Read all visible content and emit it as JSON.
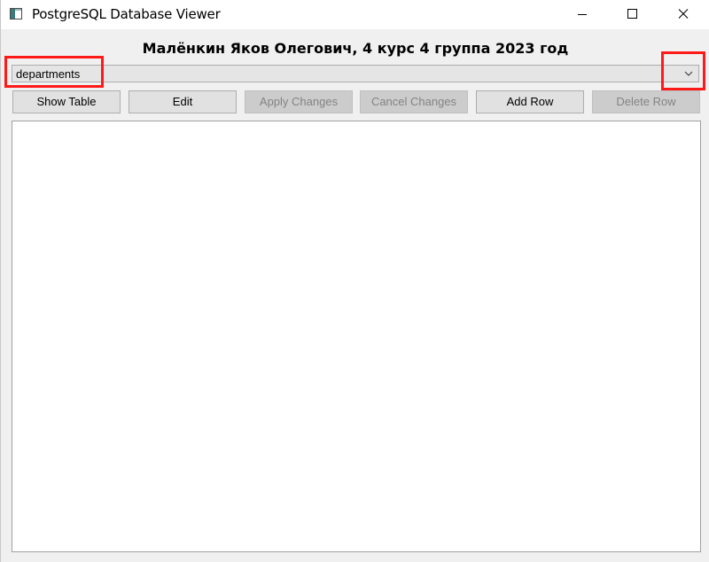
{
  "window": {
    "title": "PostgreSQL Database Viewer"
  },
  "header": {
    "text": "Малёнкин Яков Олегович, 4 курс 4 группа 2023 год"
  },
  "table_select": {
    "selected": "departments"
  },
  "toolbar": {
    "show_table_label": "Show Table",
    "edit_label": "Edit",
    "apply_changes_label": "Apply Changes",
    "cancel_changes_label": "Cancel Changes",
    "add_row_label": "Add Row",
    "delete_row_label": "Delete Row",
    "disabled": [
      "Apply Changes",
      "Cancel Changes",
      "Delete Row"
    ]
  },
  "icons": {
    "app": "app-window-icon",
    "minimize": "minimize-icon",
    "maximize": "maximize-icon",
    "close": "close-icon",
    "dropdown": "chevron-down-icon"
  },
  "colors": {
    "annotation": "#ff1a1a",
    "window_bg": "#f0f0f0",
    "button_bg": "#e1e1e1",
    "button_disabled_bg": "#cccccc",
    "disabled_text": "#838383"
  }
}
